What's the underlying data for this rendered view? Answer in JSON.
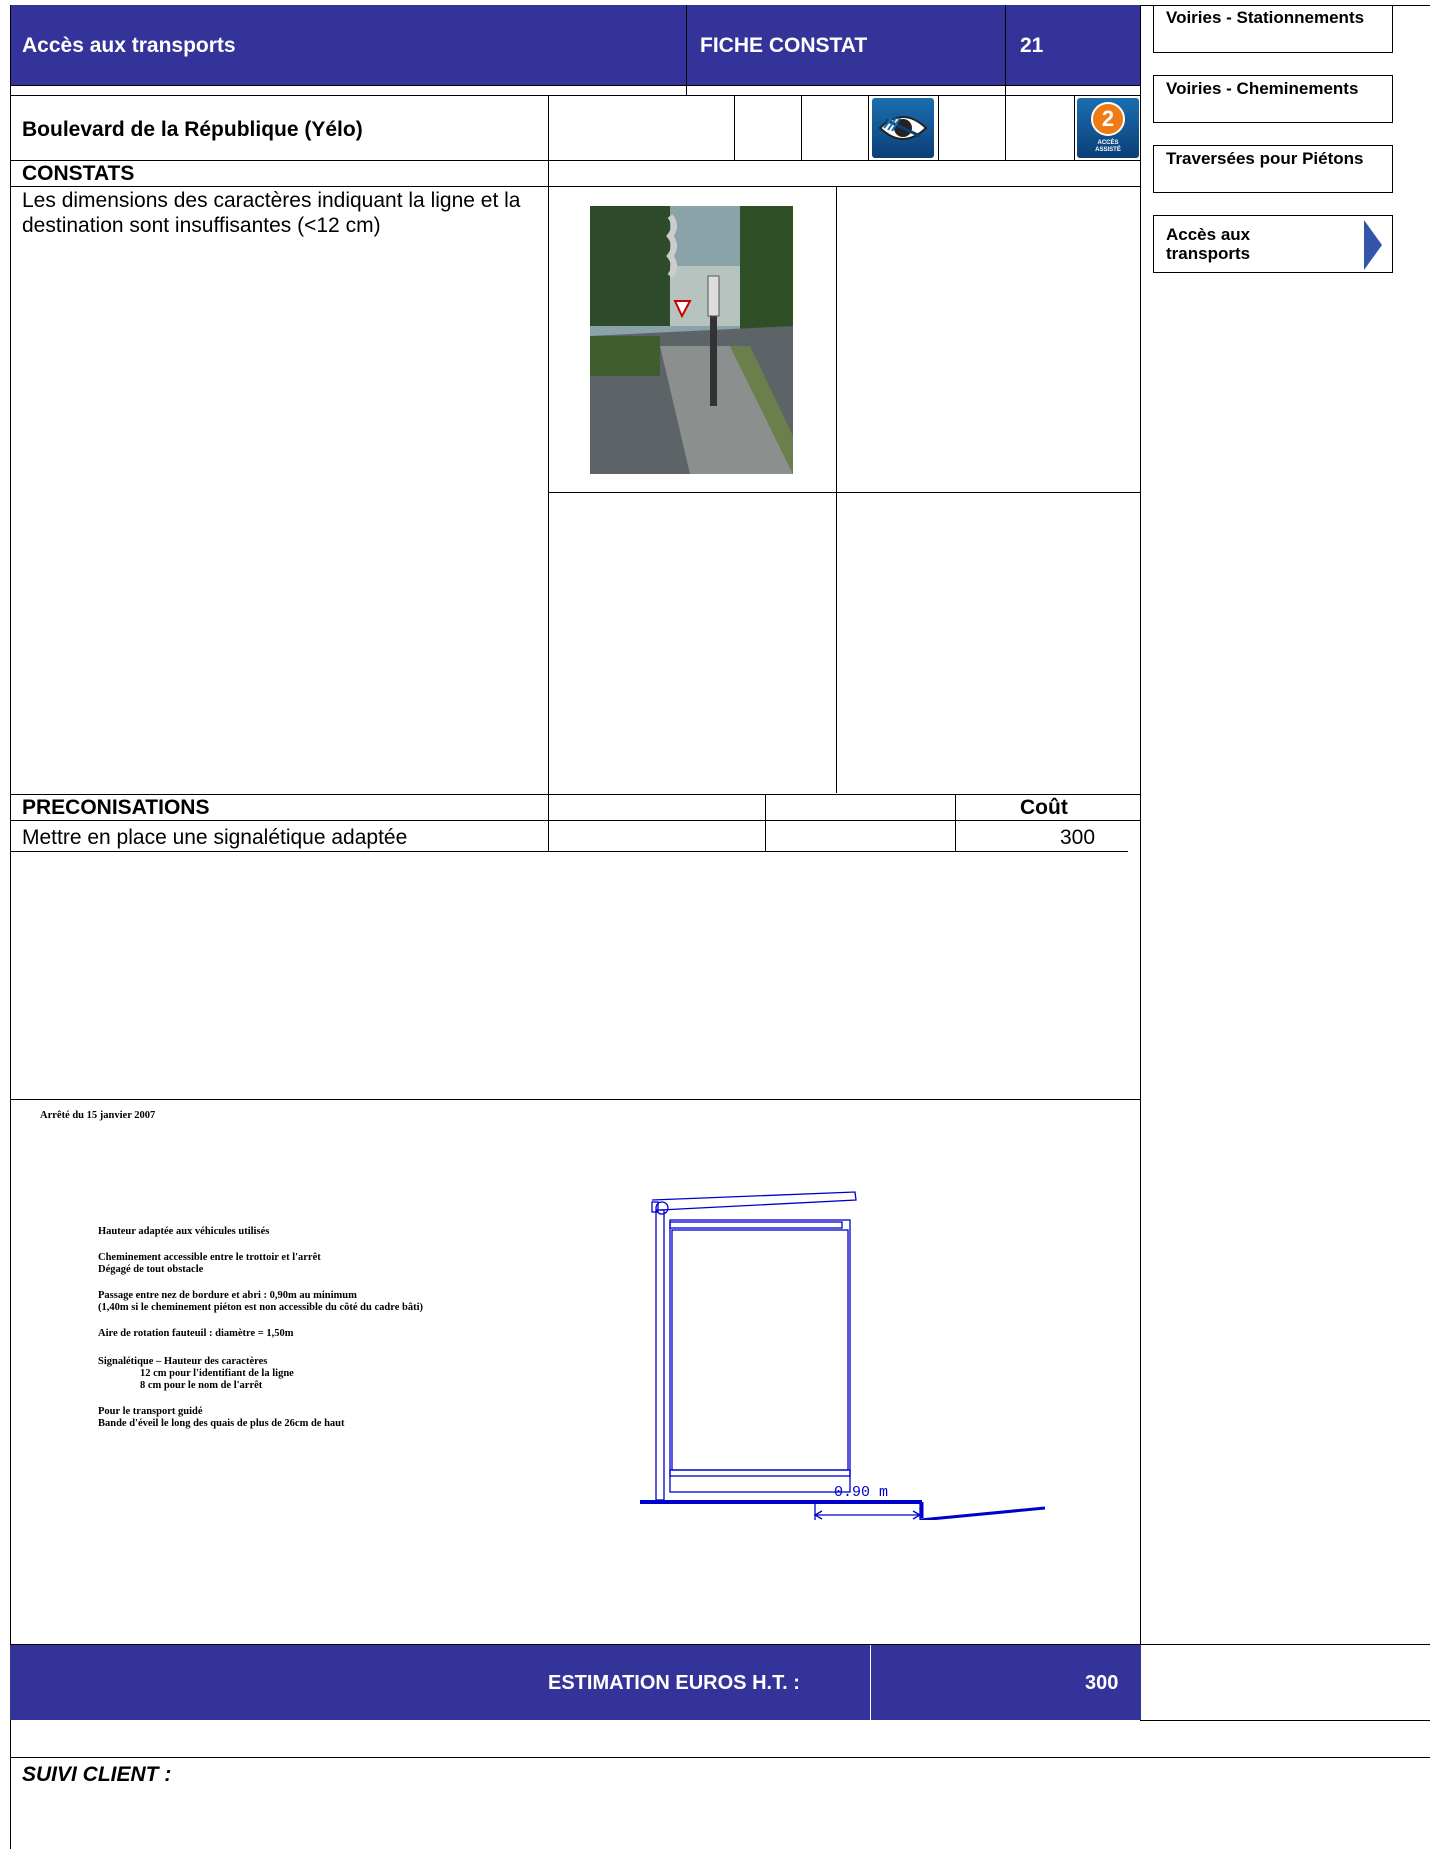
{
  "header": {
    "category": "Accès aux transports",
    "sheet_type": "FICHE CONSTAT",
    "sheet_number": "21"
  },
  "location": "Boulevard de la République (Yélo)",
  "icons": {
    "visual": "visual-impairment-icon",
    "access": {
      "number": "2",
      "text": "ACCÈS ASSISTÉ"
    }
  },
  "constats": {
    "heading": "CONSTATS",
    "text": "Les dimensions des caractères indiquant la ligne et la destination sont insuffisantes (<12 cm)"
  },
  "preconisations": {
    "heading": "PRECONISATIONS",
    "cost_header": "Coût",
    "items": [
      {
        "text": "Mettre en place une signalétique adaptée",
        "cost": "300"
      }
    ]
  },
  "regulation": {
    "title": "Arrêté du 15 janvier 2007",
    "lines": [
      "Hauteur adaptée aux véhicules utilisés",
      "Cheminement accessible entre le trottoir et l'arrêt",
      "Dégagé de tout obstacle",
      "Passage entre nez de bordure et abri : 0,90m au minimum",
      "(1,40m si le cheminement piéton est non accessible du côté du cadre bâti)",
      "Aire de rotation fauteuil : diamètre = 1,50m",
      "Signalétique – Hauteur des caractères",
      "12 cm pour l'identifiant de la ligne",
      "8 cm pour le nom de l'arrêt",
      "Pour le transport guidé",
      "Bande d'éveil le long des quais de plus de 26cm de haut"
    ],
    "dimension_label": "0.90 m"
  },
  "estimation": {
    "label": "ESTIMATION EUROS H.T. :",
    "value": "300"
  },
  "suivi": "SUIVI CLIENT :",
  "sidebar": {
    "tabs": [
      {
        "label": "Voiries - Stationnements"
      },
      {
        "label": "Voiries - Cheminements"
      },
      {
        "label": "Traversées pour Piétons"
      },
      {
        "label": "Accès aux transports",
        "active": true
      }
    ]
  },
  "colors": {
    "header_bg": "#333399",
    "drawing": "#0000cc",
    "active_arrow": "#3355aa"
  }
}
